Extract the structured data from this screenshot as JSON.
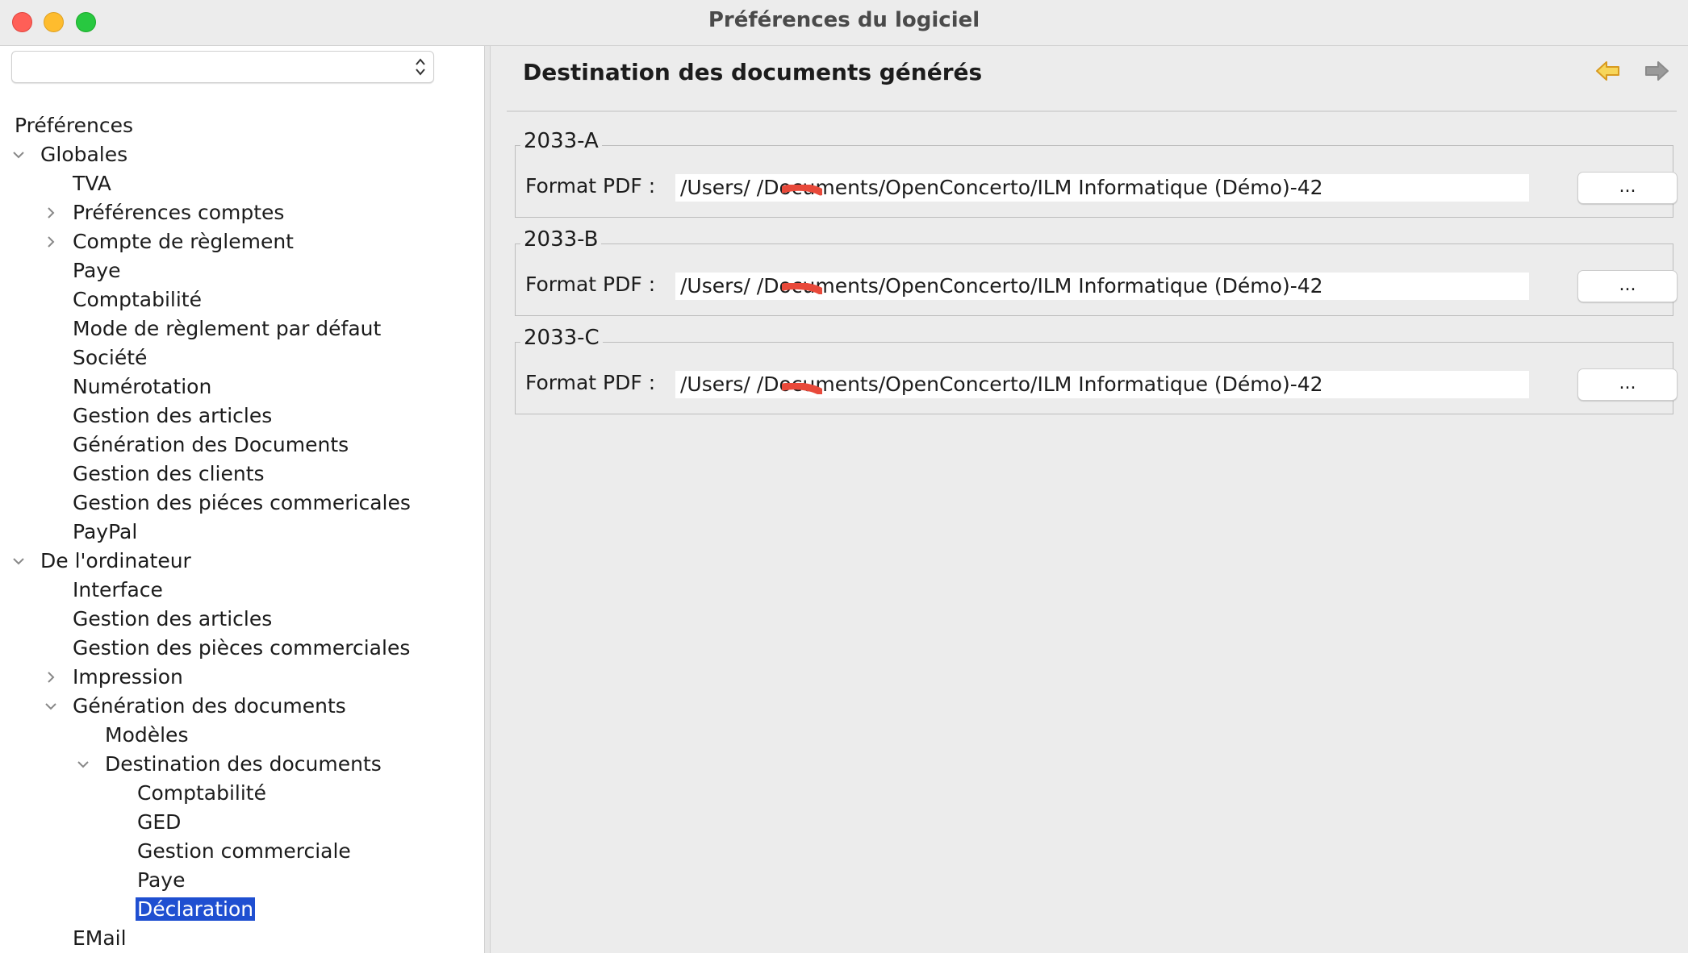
{
  "window": {
    "title": "Préférences du logiciel"
  },
  "sidebar": {
    "combo_value": "",
    "tree": [
      {
        "label": "Préférences"
      },
      {
        "label": "Globales",
        "state": "expanded"
      },
      {
        "label": "TVA"
      },
      {
        "label": "Préférences comptes",
        "state": "collapsed"
      },
      {
        "label": "Compte de règlement",
        "state": "collapsed"
      },
      {
        "label": "Paye"
      },
      {
        "label": "Comptabilité"
      },
      {
        "label": "Mode de règlement par défaut"
      },
      {
        "label": "Société"
      },
      {
        "label": "Numérotation"
      },
      {
        "label": "Gestion des articles"
      },
      {
        "label": "Génération des Documents"
      },
      {
        "label": "Gestion des clients"
      },
      {
        "label": "Gestion des piéces commericales"
      },
      {
        "label": "PayPal"
      },
      {
        "label": "De l'ordinateur",
        "state": "expanded"
      },
      {
        "label": "Interface"
      },
      {
        "label": "Gestion des articles"
      },
      {
        "label": "Gestion des pièces commerciales"
      },
      {
        "label": "Impression",
        "state": "collapsed"
      },
      {
        "label": "Génération des documents",
        "state": "expanded"
      },
      {
        "label": "Modèles"
      },
      {
        "label": "Destination des documents",
        "state": "expanded"
      },
      {
        "label": "Comptabilité"
      },
      {
        "label": "GED"
      },
      {
        "label": "Gestion commerciale"
      },
      {
        "label": "Paye"
      },
      {
        "label": "Déclaration",
        "selected": true
      },
      {
        "label": "EMail"
      }
    ]
  },
  "main": {
    "title": "Destination des documents générés",
    "back_icon": "arrow-left-icon",
    "forward_icon": "arrow-right-icon",
    "groups": [
      {
        "title": "2033-A",
        "field_label": "Format PDF :",
        "path": "/Users/     /Documents/OpenConcerto/ILM Informatique (Démo)-42",
        "button_label": "..."
      },
      {
        "title": "2033-B",
        "field_label": "Format PDF :",
        "path": "/Users/     /Documents/OpenConcerto/ILM Informatique (Démo)-42",
        "button_label": "..."
      },
      {
        "title": "2033-C",
        "field_label": "Format PDF :",
        "path": "/Users/     /Documents/OpenConcerto/ILM Informatique (Démo)-42",
        "button_label": "..."
      }
    ]
  },
  "colors": {
    "selection": "#1f4fd1",
    "redaction": "#e8493a",
    "back_arrow": "#e3a92a",
    "forward_arrow": "#8a8a8a"
  }
}
